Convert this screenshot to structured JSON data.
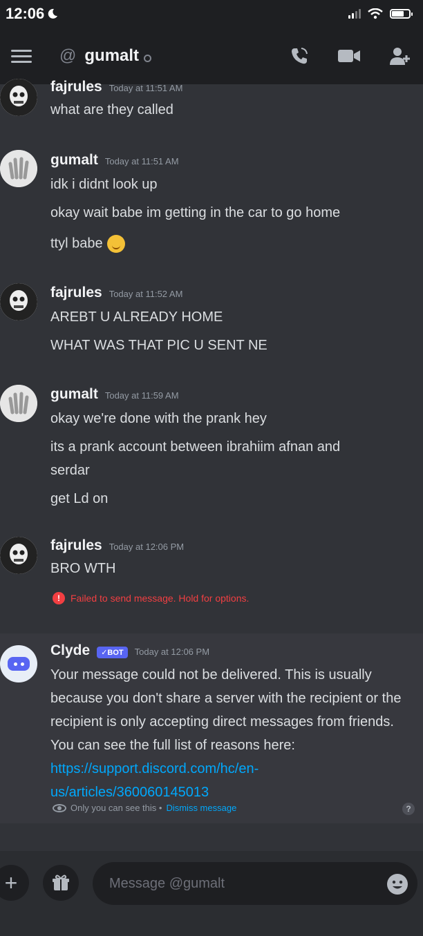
{
  "status_bar": {
    "time": "12:06"
  },
  "header": {
    "at_symbol": "@",
    "channel_name": "gumalt"
  },
  "messages": [
    {
      "username": "fajrules",
      "timestamp": "Today at 11:51 AM",
      "lines": [
        "what are they called"
      ]
    },
    {
      "username": "gumalt",
      "timestamp": "Today at 11:51 AM",
      "lines": [
        "idk i didnt look up",
        "okay wait babe im getting in the car to go home",
        "ttyl babe"
      ]
    },
    {
      "username": "fajrules",
      "timestamp": "Today at 11:52 AM",
      "lines": [
        "AREBT U ALREADY HOME",
        "WHAT WAS THAT PIC U SENT NE"
      ]
    },
    {
      "username": "gumalt",
      "timestamp": "Today at 11:59 AM",
      "lines": [
        "okay we're done with the prank hey",
        "its a prank account between ibrahiim afnan and",
        "serdar",
        "get Ld on"
      ]
    },
    {
      "username": "fajrules",
      "timestamp": "Today at 12:06 PM",
      "lines": [
        "BRO WTH"
      ]
    }
  ],
  "failed_notice": {
    "icon": "!",
    "text": "Failed to send message. Hold for options."
  },
  "clyde": {
    "username": "Clyde",
    "bot_tag": "✓BOT",
    "timestamp": "Today at 12:06 PM",
    "text": "Your message could not be delivered. This is usually because you don't share a server with the recipient or the recipient is only accepting direct messages from friends. You can see the full list of reasons here: ",
    "link": "https://support.discord.com/hc/en-us/articles/360060145013",
    "only_you": "Only you can see this •",
    "dismiss": "Dismiss message",
    "help_icon": "?"
  },
  "composer": {
    "plus": "+",
    "placeholder": "Message @gumalt"
  },
  "colors": {
    "background": "#313338",
    "header": "#1e1f22",
    "error": "#f23f42",
    "link": "#00a8fc",
    "bot_tag": "#5865f2"
  }
}
